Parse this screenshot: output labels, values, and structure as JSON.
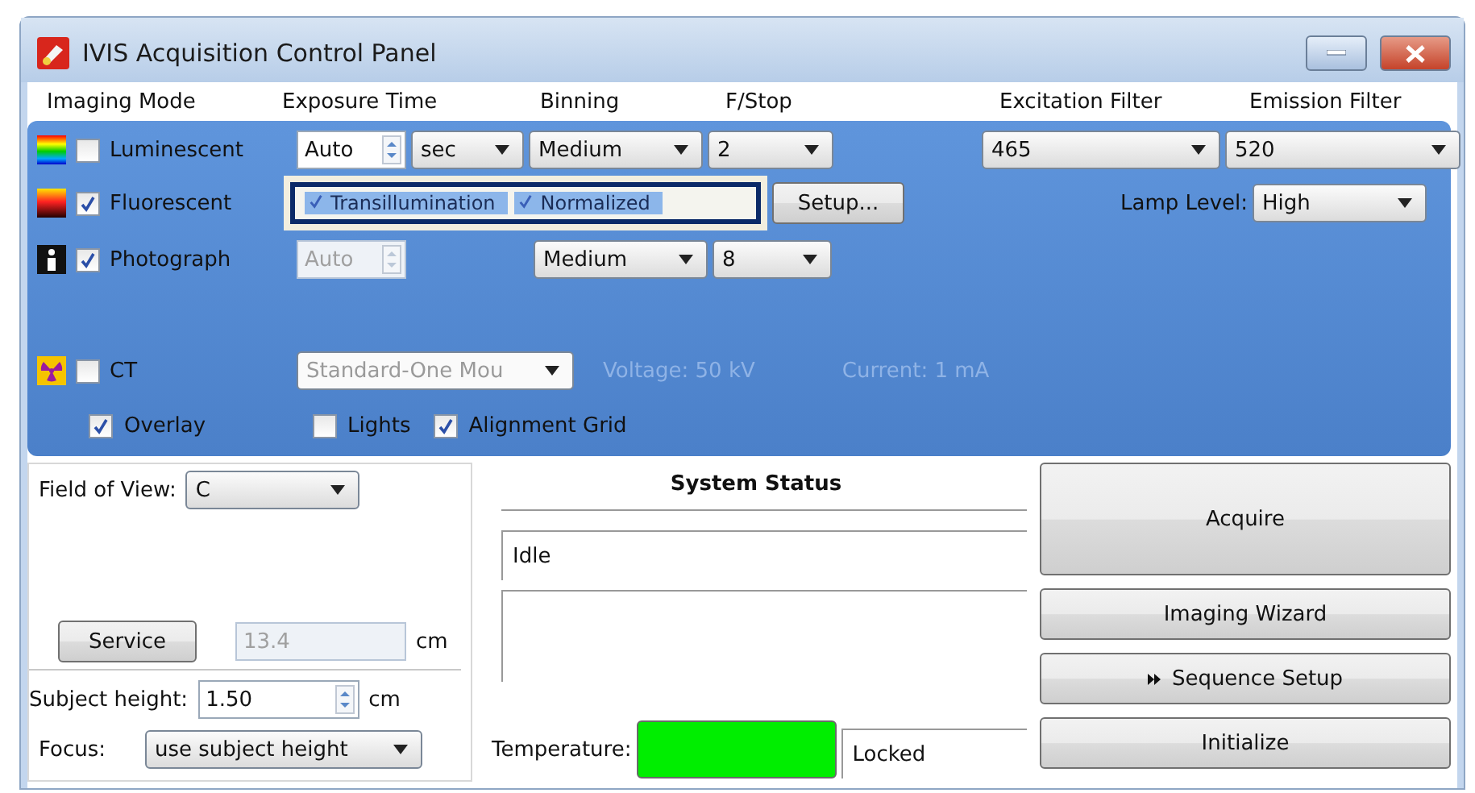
{
  "window": {
    "title": "IVIS Acquisition Control Panel"
  },
  "column_headers": [
    "Imaging Mode",
    "Exposure Time",
    "Binning",
    "F/Stop",
    "Excitation Filter",
    "Emission Filter"
  ],
  "luminescent": {
    "label": "Luminescent",
    "checked": false,
    "exposure": {
      "value": "Auto",
      "disabled": false
    },
    "exposure_unit": "sec",
    "binning": "Medium",
    "fstop": "2",
    "excitation_filter": "465",
    "emission_filter": "520"
  },
  "fluorescent": {
    "label": "Fluorescent",
    "checked": true,
    "options": [
      {
        "label": "Transillumination",
        "checked": true
      },
      {
        "label": "Normalized",
        "checked": true
      }
    ],
    "setup_button": "Setup...",
    "lamp_level_label": "Lamp Level:",
    "lamp_level": "High"
  },
  "photograph": {
    "label": "Photograph",
    "checked": true,
    "exposure": {
      "value": "Auto",
      "disabled": true
    },
    "binning": "Medium",
    "fstop": "8"
  },
  "ct": {
    "label": "CT",
    "checked": false,
    "disabled": true,
    "protocol": "Standard-One Mou",
    "voltage": "Voltage: 50 kV",
    "current": "Current: 1 mA"
  },
  "display_options": [
    {
      "label": "Overlay",
      "checked": true
    },
    {
      "label": "Lights",
      "checked": false
    },
    {
      "label": "Alignment Grid",
      "checked": true
    }
  ],
  "field_of_view": {
    "label": "Field of View:",
    "value": "C"
  },
  "service_button": "Service",
  "subject_distance": {
    "value": "13.4",
    "unit": "cm"
  },
  "subject_height": {
    "label": "Subject height:",
    "value": "1.50",
    "unit": "cm"
  },
  "focus": {
    "label": "Focus:",
    "value": "use subject height"
  },
  "system_status": {
    "title": "System Status",
    "status": "Idle",
    "temperature_label": "Temperature:",
    "temperature_ok": true,
    "lock_status": "Locked"
  },
  "actions": [
    "Acquire",
    "Imaging Wizard",
    "Sequence Setup",
    "Initialize"
  ]
}
